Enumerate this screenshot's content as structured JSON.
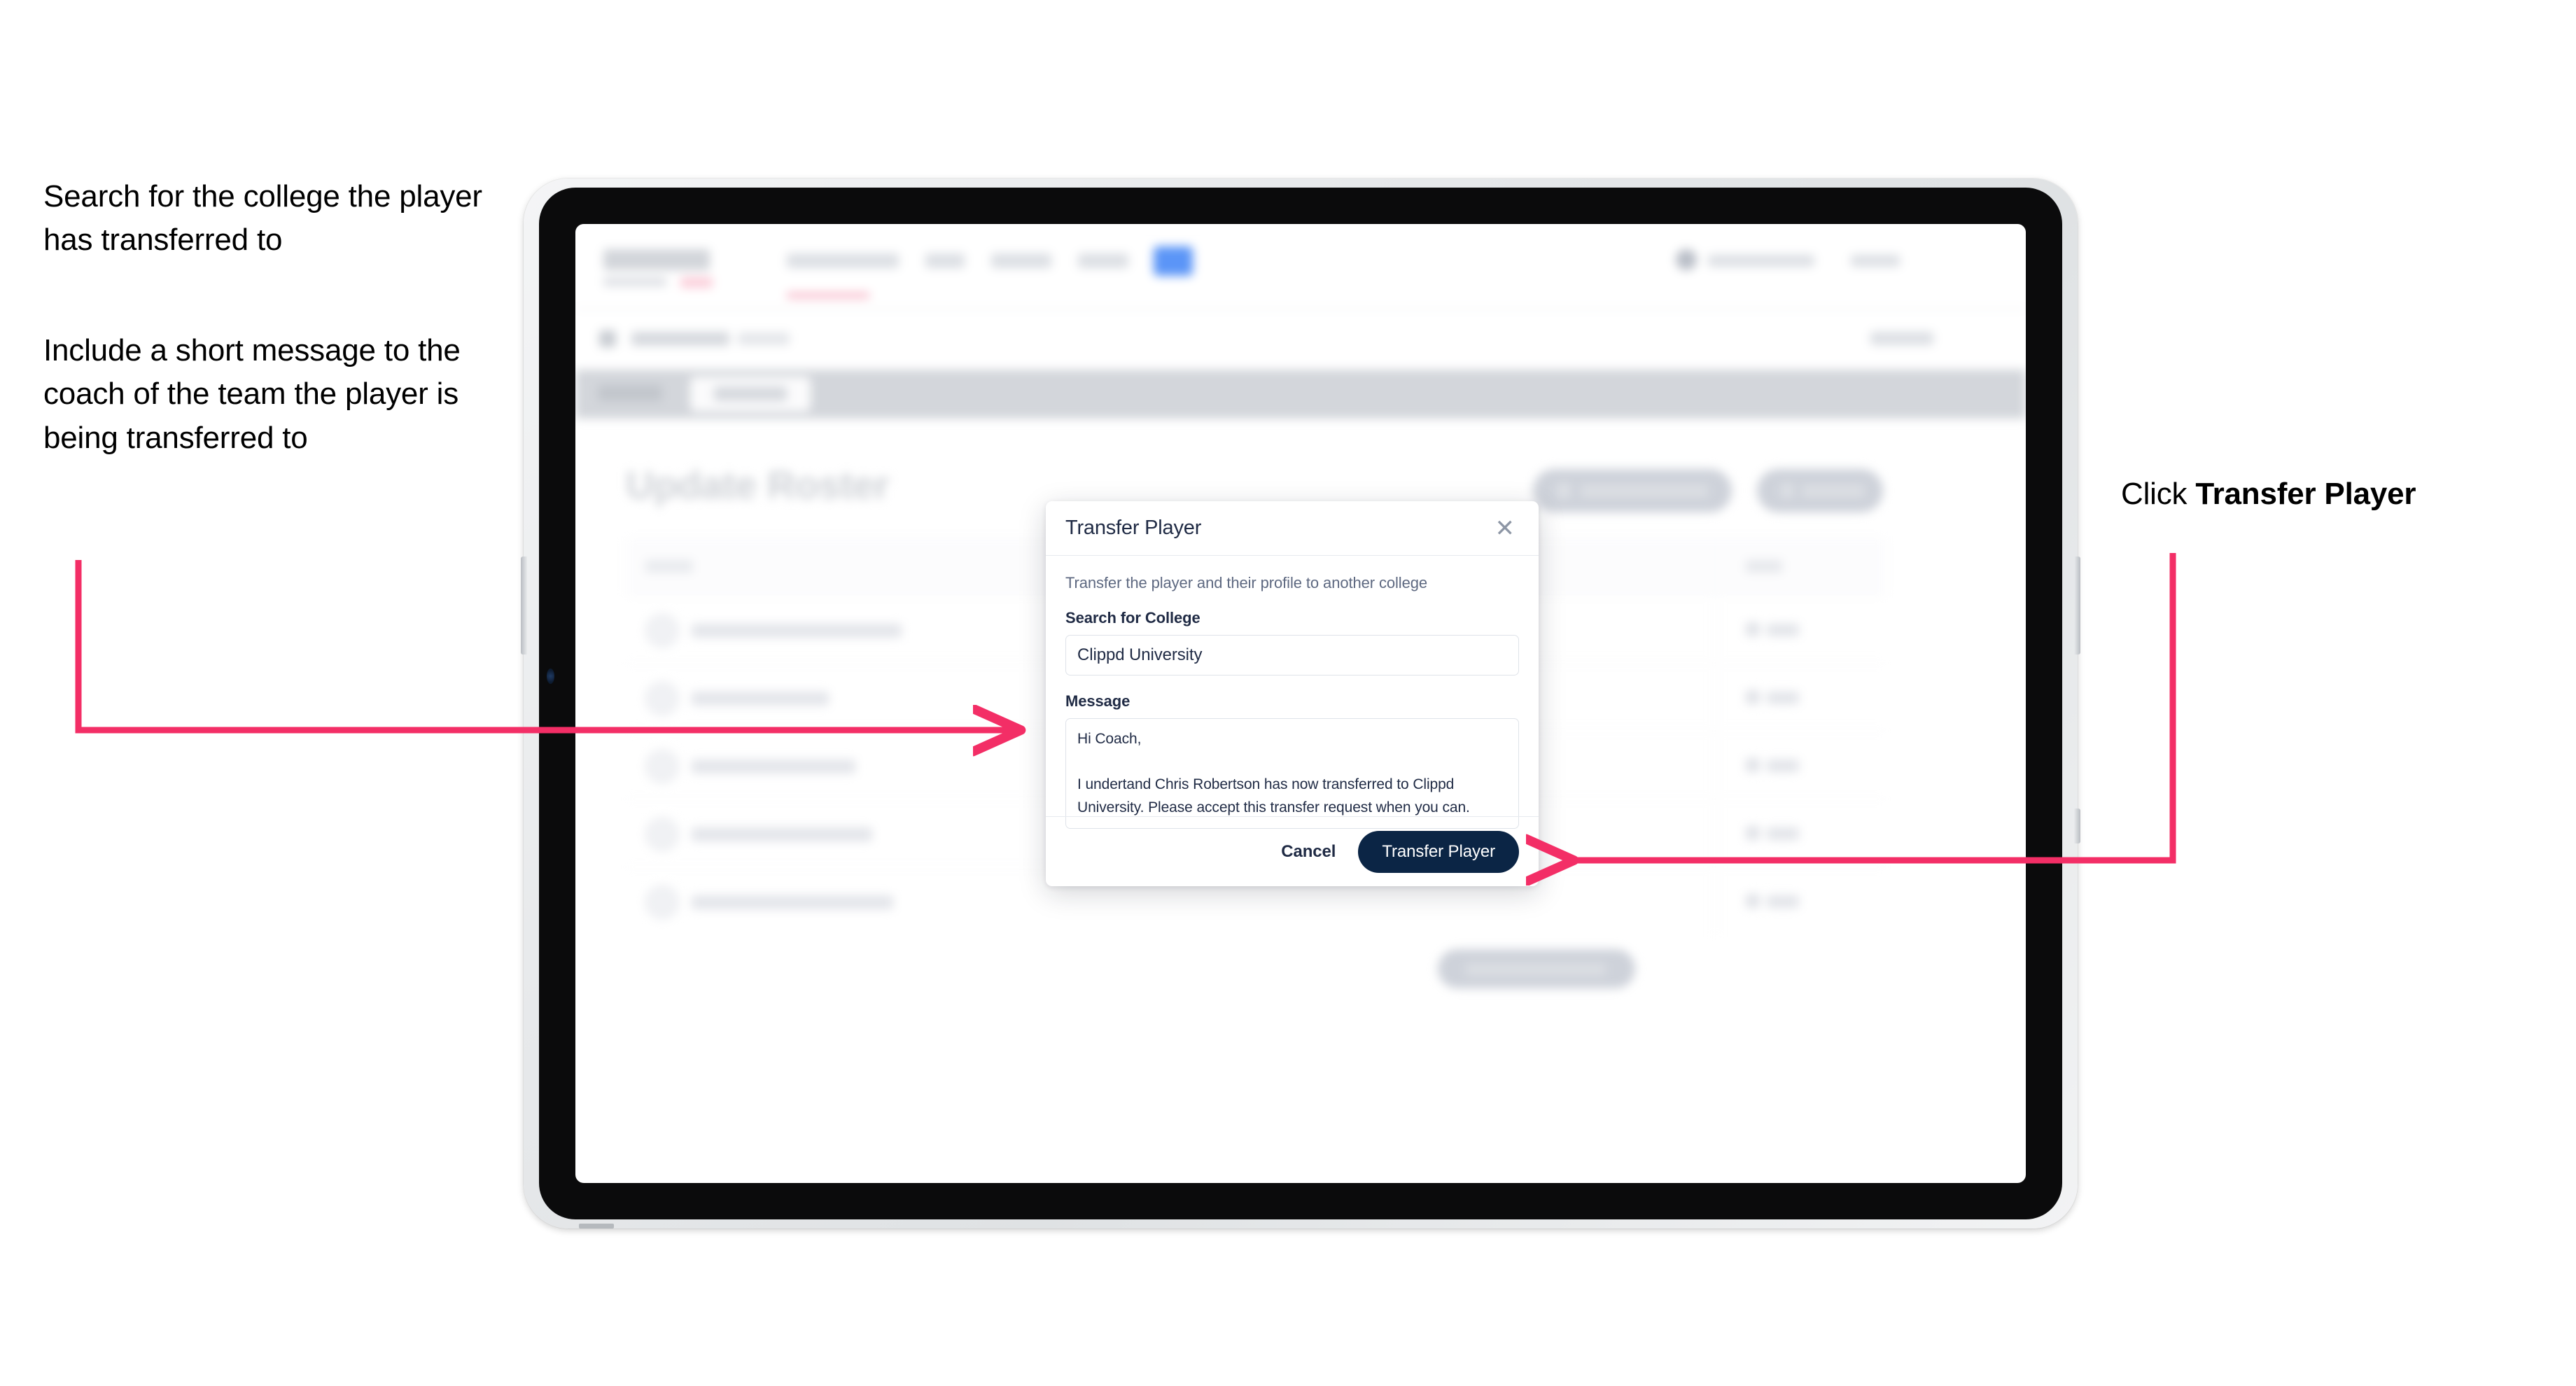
{
  "annotations": {
    "left_top": "Search for the college the player has transferred to",
    "left_bottom": "Include a short message to the coach of the team the player is being transferred to",
    "right_prefix": "Click ",
    "right_bold": "Transfer Player"
  },
  "app": {
    "page_title": "Update Roster"
  },
  "modal": {
    "title": "Transfer Player",
    "close_icon": "close-icon",
    "subtitle": "Transfer the player and their profile to another college",
    "college_label": "Search for College",
    "college_value": "Clippd University",
    "college_placeholder": "Search for College",
    "message_label": "Message",
    "message_value": "Hi Coach,\n\nI undertand Chris Robertson has now transferred to Clippd University. Please accept this transfer request when you can.",
    "message_placeholder": "Message",
    "cancel_label": "Cancel",
    "submit_label": "Transfer Player"
  },
  "colors": {
    "accent_pink": "#F32E66",
    "primary_navy": "#0B2545",
    "text_dark": "#1F2A44",
    "muted": "#5D6880"
  }
}
